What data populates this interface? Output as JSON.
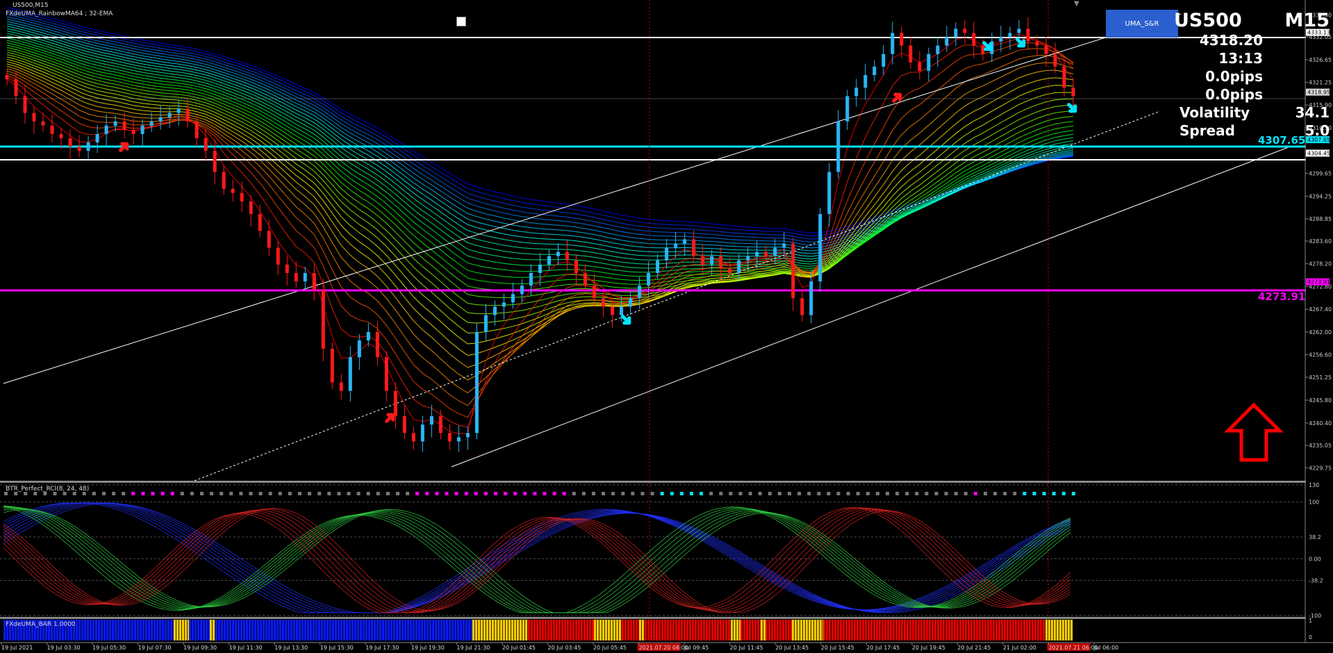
{
  "header": {
    "symbol_timeframe": "US500,M15",
    "indicator_main": "FXdeUMA_RainbowMA64 ; 32-EMA"
  },
  "panel": {
    "button_label": "UMA_S&R",
    "symbol": "US500",
    "timeframe": "M15",
    "price": "4318.20",
    "countdown": "13:13",
    "pips1": "0.0pips",
    "pips2": "0.0pips",
    "volatility_label": "Volatility",
    "volatility_value": "34.1",
    "spread_label": "Spread",
    "spread_value": "5.0"
  },
  "levels": {
    "cyan_label": "4307.65",
    "magenta_label": "4273.91",
    "top_white_tag": "4333.13",
    "current_price_tag": "4318.95",
    "white2_tag": "4304.45",
    "cyan_tag": "4307.65",
    "magenta_tag": "4273.91"
  },
  "subwindows": {
    "rci_label": "BTR_Perfect_RCI(8, 24, 48)",
    "bar_label": "FXdeUMA_BAR 1.0000"
  },
  "time_axis": {
    "labels": [
      "19 Jul 2021",
      "19 Jul 03:30",
      "19 Jul 05:30",
      "19 Jul 07:30",
      "19 Jul 09:30",
      "19 Jul 11:30",
      "19 Jul 13:30",
      "19 Jul 15:30",
      "19 Jul 17:30",
      "19 Jul 19:30",
      "19 Jul 21:30",
      "20 Jul 01:45",
      "20 Jul 03:45",
      "20 Jul 05:45",
      "2021.07.20 08:00",
      "Jul 09:45",
      "20 Jul 11:45",
      "20 Jul 13:45",
      "20 Jul 15:45",
      "20 Jul 17:45",
      "20 Jul 19:45",
      "20 Jul 21:45",
      "21 Jul 02:00",
      "2021.07.21 06:00",
      "Jul 06:00"
    ]
  },
  "colors": {
    "background": "#000000",
    "bull_candle": "#29b6f6",
    "bear_candle": "#ff1a1a",
    "cyan_level": "#00e5ff",
    "magenta_level": "#ff00ff",
    "bar_blue": "#0a1aff",
    "bar_yellow": "#ffcc00",
    "bar_red": "#e60000"
  },
  "chart_data": [
    {
      "type": "candlestick",
      "title": "US500,M15",
      "ylim": [
        4227,
        4340
      ],
      "yticks": [
        "4337.30",
        "4332.05",
        "4326.65",
        "4321.25",
        "4315.90",
        "4310.50",
        "4299.65",
        "4294.25",
        "4288.85",
        "4283.60",
        "4278.20",
        "4272.80",
        "4267.40",
        "4262.00",
        "4256.60",
        "4251.25",
        "4245.80",
        "4240.40",
        "4235.05",
        "4229.75"
      ],
      "horizontal_levels": [
        4333.13,
        4307.65,
        4304.45,
        4273.91,
        4318.95
      ],
      "close_series": [
        4322,
        4318,
        4314,
        4312,
        4311,
        4309,
        4308,
        4306,
        4305,
        4307,
        4309,
        4311,
        4312,
        4310,
        4309,
        4311,
        4312,
        4313,
        4314,
        4315,
        4312,
        4308,
        4305,
        4300,
        4296,
        4295,
        4293,
        4290,
        4286,
        4282,
        4278,
        4276,
        4274,
        4276,
        4272,
        4258,
        4250,
        4248,
        4256,
        4260,
        4262,
        4256,
        4248,
        4242,
        4238,
        4236,
        4240,
        4242,
        4238,
        4236,
        4237,
        4238,
        4262,
        4266,
        4268,
        4269,
        4271,
        4273,
        4276,
        4278,
        4280,
        4281,
        4279,
        4276,
        4273,
        4270,
        4268,
        4266,
        4268,
        4270,
        4273,
        4276,
        4279,
        4282,
        4283,
        4284,
        4280,
        4278,
        4280,
        4277,
        4276,
        4279,
        4280,
        4281,
        4280,
        4282,
        4283,
        4270,
        4266,
        4274,
        4290,
        4300,
        4312,
        4318,
        4320,
        4323,
        4325,
        4328,
        4333,
        4330,
        4326,
        4324,
        4328,
        4330,
        4332,
        4334,
        4333,
        4330,
        4328,
        4331,
        4332,
        4333,
        4334,
        4331,
        4330,
        4328,
        4325,
        4320,
        4318
      ]
    },
    {
      "type": "line",
      "title": "BTR_Perfect_RCI(8, 24, 48)",
      "ylim": [
        -100,
        130
      ],
      "yticks": [
        "130",
        "100",
        "38.2",
        "0.00",
        "-38.2",
        "-100"
      ]
    },
    {
      "type": "bar",
      "title": "FXdeUMA_BAR 1.0000",
      "ylim": [
        0,
        1
      ],
      "yticks": [
        "1",
        "0"
      ]
    }
  ]
}
